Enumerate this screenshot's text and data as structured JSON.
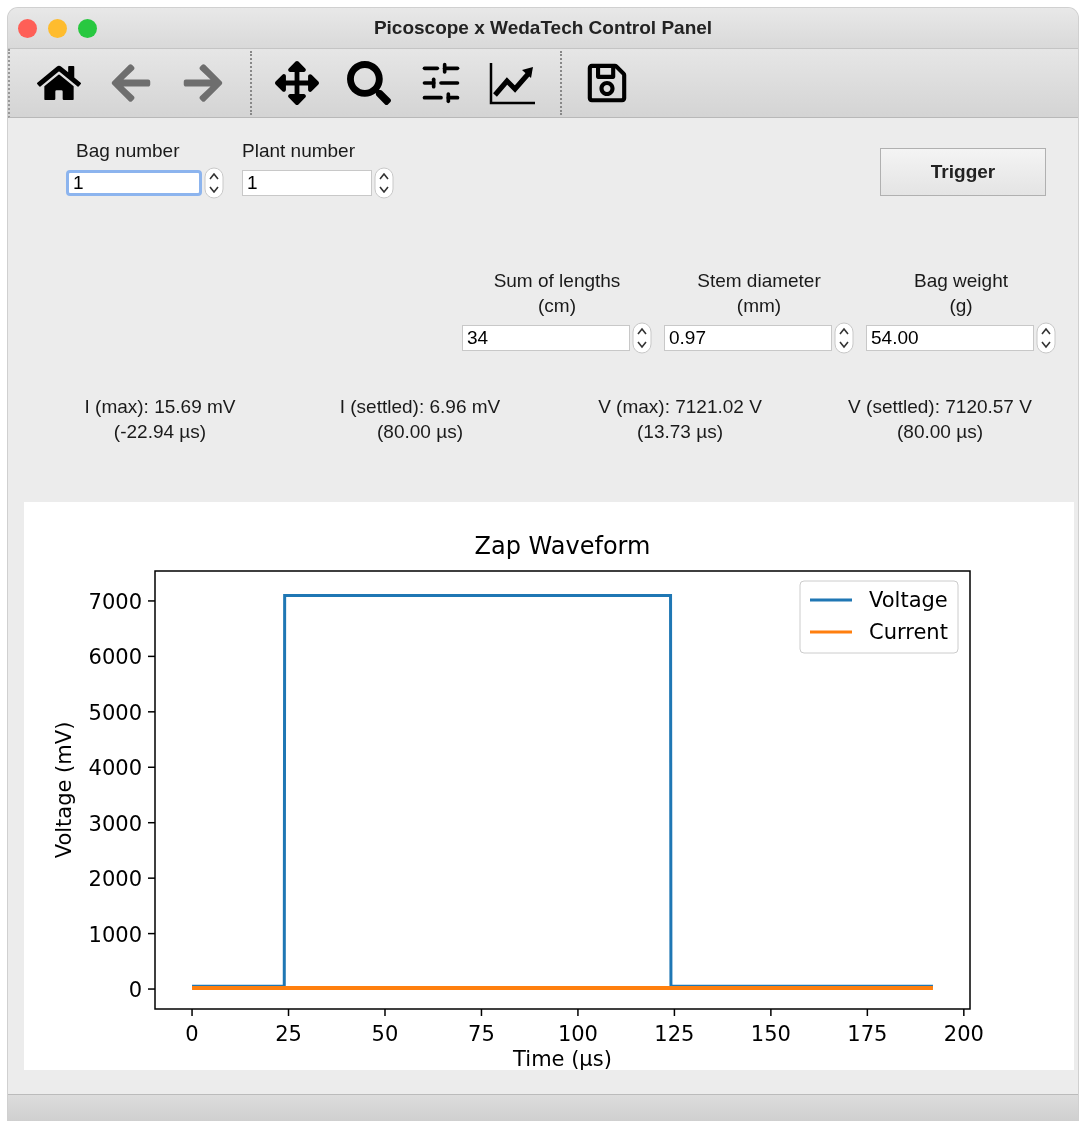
{
  "window": {
    "title": "Picoscope x WedaTech Control Panel"
  },
  "toolbar": {
    "groups": [
      [
        {
          "disabled": false
        },
        {
          "disabled": true
        },
        {
          "disabled": true
        }
      ],
      [
        {
          "disabled": false
        },
        {
          "disabled": false
        },
        {
          "disabled": false
        },
        {
          "disabled": false
        }
      ],
      [
        {
          "disabled": false
        }
      ]
    ]
  },
  "top_fields": [
    {
      "label": "Bag number",
      "value": "1",
      "focused": true
    },
    {
      "label": "Plant number",
      "value": "1",
      "focused": false
    }
  ],
  "trigger_button": {
    "label": "Trigger"
  },
  "measure_fields": [
    {
      "label": "Sum of lengths",
      "unit": "(cm)",
      "value": "34",
      "focused": false
    },
    {
      "label": "Stem diameter",
      "unit": "(mm)",
      "value": "0.97",
      "focused": false
    },
    {
      "label": "Bag weight",
      "unit": "(g)",
      "value": "54.00",
      "focused": false
    }
  ],
  "readings": [
    {
      "value": "I (max): 15.69 mV",
      "time": "(-22.94 µs)"
    },
    {
      "value": "I (settled): 6.96 mV",
      "time": "(80.00 µs)"
    },
    {
      "value": "V (max): 7121.02 V",
      "time": "(13.73 µs)"
    },
    {
      "value": "V (settled): 7120.57 V",
      "time": "(80.00 µs)"
    }
  ],
  "chart": {
    "chart_data": {
      "type": "line",
      "title": "Zap Waveform",
      "xlabel": "Time (µs)",
      "ylabel": "Voltage (mV)",
      "x": [
        0,
        23.9,
        24,
        124,
        124.1,
        192
      ],
      "series": [
        {
          "name": "Voltage",
          "color": "#1f77b4",
          "values": [
            50,
            50,
            7100,
            7100,
            50,
            50
          ]
        },
        {
          "name": "Current",
          "color": "#ff7f0e",
          "values": [
            20,
            20,
            20,
            20,
            20,
            20
          ]
        }
      ],
      "xlim": [
        -9.6,
        201.6
      ],
      "ylim": [
        -360,
        7540
      ],
      "xticks": [
        0,
        25,
        50,
        75,
        100,
        125,
        150,
        175,
        200
      ],
      "yticks": [
        0,
        1000,
        2000,
        3000,
        4000,
        5000,
        6000,
        7000
      ],
      "legend": "upper right"
    }
  }
}
